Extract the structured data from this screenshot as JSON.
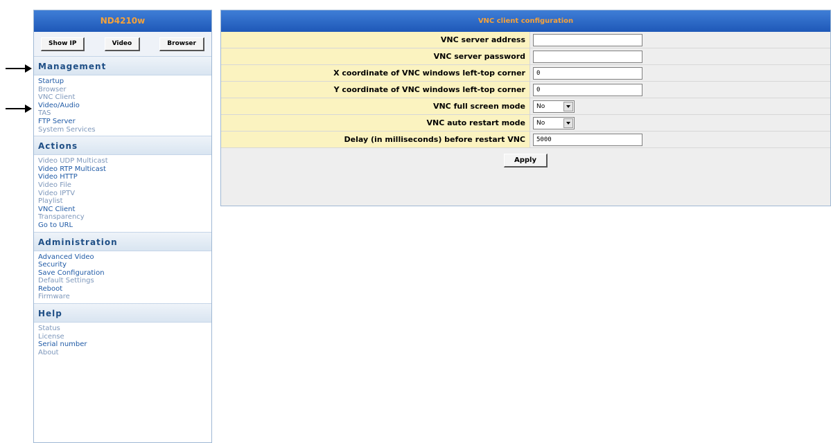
{
  "device_name": "ND4210w",
  "top_buttons": [
    "Show IP",
    "Video",
    "Browser"
  ],
  "sections": [
    {
      "title": "Management",
      "items": [
        {
          "label": "Startup",
          "faded": false
        },
        {
          "label": "Browser",
          "faded": true
        },
        {
          "label": "VNC Client",
          "faded": true
        },
        {
          "label": "Video/Audio",
          "faded": false
        },
        {
          "label": "TAS",
          "faded": true
        },
        {
          "label": "FTP Server",
          "faded": false
        },
        {
          "label": "System Services",
          "faded": true
        }
      ]
    },
    {
      "title": "Actions",
      "items": [
        {
          "label": "Video UDP Multicast",
          "faded": true
        },
        {
          "label": "Video RTP Multicast",
          "faded": false
        },
        {
          "label": "Video HTTP",
          "faded": false
        },
        {
          "label": "Video File",
          "faded": true
        },
        {
          "label": "Video IPTV",
          "faded": true
        },
        {
          "label": "Playlist",
          "faded": true
        },
        {
          "label": "VNC Client",
          "faded": false
        },
        {
          "label": "Transparency",
          "faded": true
        },
        {
          "label": "Go to URL",
          "faded": false
        }
      ]
    },
    {
      "title": "Administration",
      "items": [
        {
          "label": "Advanced Video",
          "faded": false
        },
        {
          "label": "Security",
          "faded": false
        },
        {
          "label": "Save Configuration",
          "faded": false
        },
        {
          "label": "Default Settings",
          "faded": true
        },
        {
          "label": "Reboot",
          "faded": false
        },
        {
          "label": "Firmware",
          "faded": true
        }
      ]
    },
    {
      "title": "Help",
      "items": [
        {
          "label": "Status",
          "faded": true
        },
        {
          "label": "License",
          "faded": true
        },
        {
          "label": "Serial number",
          "faded": false
        },
        {
          "label": "About",
          "faded": true
        }
      ]
    }
  ],
  "panel": {
    "title": "VNC client configuration",
    "rows": [
      {
        "label": "VNC server address",
        "type": "text",
        "value": ""
      },
      {
        "label": "VNC server password",
        "type": "text",
        "value": ""
      },
      {
        "label": "X coordinate of VNC windows left-top corner",
        "type": "text",
        "value": "0"
      },
      {
        "label": "Y coordinate of VNC windows left-top corner",
        "type": "text",
        "value": "0"
      },
      {
        "label": "VNC full screen mode",
        "type": "select",
        "value": "No"
      },
      {
        "label": "VNC auto restart mode",
        "type": "select",
        "value": "No"
      },
      {
        "label": "Delay (in milliseconds) before restart VNC",
        "type": "text",
        "value": "5000"
      }
    ],
    "apply_label": "Apply"
  },
  "colors": {
    "title_bar_blue": "#1e58b8",
    "title_text_orange": "#f6a23a",
    "section_head_text": "#1f4f86",
    "link_blue": "#1f5aa6",
    "label_cell_bg": "#fbf3c0"
  }
}
